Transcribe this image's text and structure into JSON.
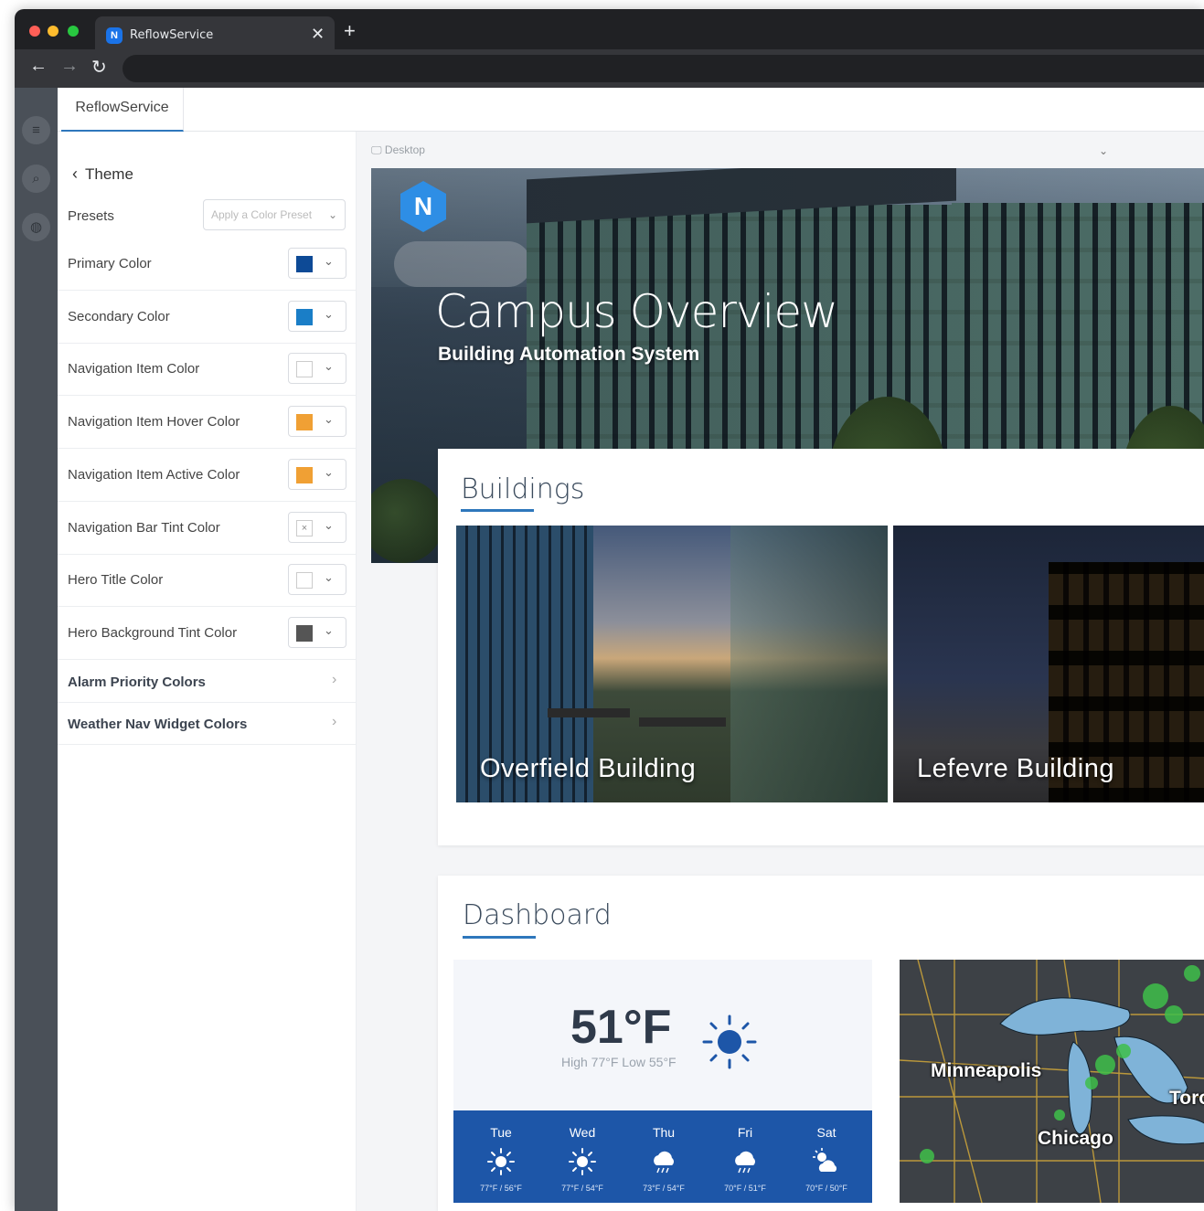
{
  "browser": {
    "tab_title": "ReflowService",
    "tab_favicon_letter": "N",
    "close_glyph": "✕",
    "new_tab_glyph": "+",
    "back_glyph": "←",
    "forward_glyph": "→",
    "reload_glyph": "↻"
  },
  "app": {
    "tab_label": "ReflowService"
  },
  "theme_panel": {
    "back_label": "Theme",
    "presets_label": "Presets",
    "presets_placeholder": "Apply a Color Preset",
    "color_rows": [
      {
        "label": "Primary Color",
        "color": "#0d4a96"
      },
      {
        "label": "Secondary Color",
        "color": "#1a7ec7"
      },
      {
        "label": "Navigation Item Color",
        "color": "#ffffff"
      },
      {
        "label": "Navigation Item Hover Color",
        "color": "#f0a034"
      },
      {
        "label": "Navigation Item Active Color",
        "color": "#f0a034"
      },
      {
        "label": "Navigation Bar Tint Color",
        "color": "none"
      },
      {
        "label": "Hero Title Color",
        "color": "#ffffff"
      },
      {
        "label": "Hero Background Tint Color",
        "color": "#555555"
      }
    ],
    "sections": [
      {
        "label": "Alarm Priority Colors"
      },
      {
        "label": "Weather Nav Widget Colors"
      }
    ]
  },
  "preview": {
    "device_label": "Desktop",
    "hero": {
      "logo_letter": "N",
      "title": "Campus Overview",
      "subtitle": "Building Automation System"
    },
    "buildings": {
      "title": "Buildings",
      "items": [
        {
          "name": "Overfield Building"
        },
        {
          "name": "Lefevre Building"
        }
      ]
    },
    "dashboard": {
      "title": "Dashboard",
      "weather": {
        "current_temp": "51°F",
        "high_low": "High 77°F Low 55°F",
        "current_icon": "sun-icon",
        "forecast": [
          {
            "day": "Tue",
            "icon": "sun-icon",
            "temps": "77°F / 56°F"
          },
          {
            "day": "Wed",
            "icon": "sun-icon",
            "temps": "77°F / 54°F"
          },
          {
            "day": "Thu",
            "icon": "rain-cloud-icon",
            "temps": "73°F / 54°F"
          },
          {
            "day": "Fri",
            "icon": "rain-cloud-icon",
            "temps": "70°F / 51°F"
          },
          {
            "day": "Sat",
            "icon": "partly-cloudy-icon",
            "temps": "70°F / 50°F"
          }
        ]
      },
      "map": {
        "labels": [
          "Minneapolis",
          "Chicago",
          "Toro"
        ]
      }
    }
  },
  "colors": {
    "accent": "#2e77bc",
    "forecast_bar": "#1d56a8",
    "hero_logo": "#2e8ee5"
  }
}
